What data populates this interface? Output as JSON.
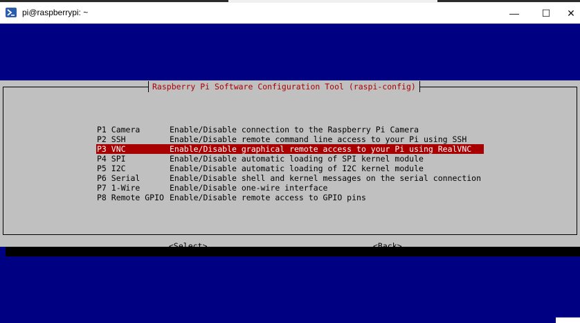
{
  "window": {
    "title": "pi@raspberrypi: ~",
    "icon": "terminal-icon",
    "minimize_glyph": "—",
    "maximize_glyph": "☐",
    "close_glyph": "✕"
  },
  "dialog": {
    "title": "Raspberry Pi Software Configuration Tool (raspi-config)",
    "items": [
      {
        "code": "P1 Camera",
        "desc": "Enable/Disable connection to the Raspberry Pi Camera",
        "selected": false
      },
      {
        "code": "P2 SSH",
        "desc": "Enable/Disable remote command line access to your Pi using SSH",
        "selected": false
      },
      {
        "code": "P3 VNC",
        "desc": "Enable/Disable graphical remote access to your Pi using RealVNC",
        "selected": true
      },
      {
        "code": "P4 SPI",
        "desc": "Enable/Disable automatic loading of SPI kernel module",
        "selected": false
      },
      {
        "code": "P5 I2C",
        "desc": "Enable/Disable automatic loading of I2C kernel module",
        "selected": false
      },
      {
        "code": "P6 Serial",
        "desc": "Enable/Disable shell and kernel messages on the serial connection",
        "selected": false
      },
      {
        "code": "P7 1-Wire",
        "desc": "Enable/Disable one-wire interface",
        "selected": false
      },
      {
        "code": "P8 Remote GPIO",
        "desc": "Enable/Disable remote access to GPIO pins",
        "selected": false
      }
    ],
    "select_label": "<Select>",
    "back_label": "<Back>"
  },
  "colors": {
    "terminal_bg": "#000082",
    "dialog_bg": "#c0c0c0",
    "title_red": "#aa0000",
    "selection_bg": "#a80000"
  }
}
